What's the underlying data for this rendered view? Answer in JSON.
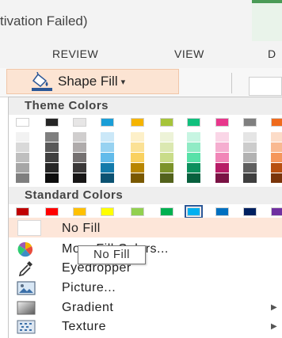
{
  "window": {
    "title": "tivation Failed)"
  },
  "tabs": [
    {
      "label": "REVIEW"
    },
    {
      "label": "VIEW"
    },
    {
      "label": "D"
    }
  ],
  "ribbon": {
    "shape_fill_label": "Shape Fill",
    "shape_fill_icon": "paint-bucket-icon",
    "caret": "▾"
  },
  "menu": {
    "theme_colors_header": "Theme Colors",
    "standard_colors_header": "Standard Colors",
    "theme_colors": [
      {
        "base": "#ffffff",
        "shades": [
          "#f2f2f2",
          "#d9d9d9",
          "#bfbfbf",
          "#a6a6a6",
          "#7f7f7f"
        ]
      },
      {
        "base": "#262626",
        "shades": [
          "#7f7f7f",
          "#595959",
          "#404040",
          "#262626",
          "#0d0d0d"
        ]
      },
      {
        "base": "#e7e6e6",
        "shades": [
          "#d0cece",
          "#afabab",
          "#757171",
          "#3a3838",
          "#171616"
        ]
      },
      {
        "base": "#1a9ed7",
        "shades": [
          "#cbe8f8",
          "#97d2f1",
          "#62bbea",
          "#137bab",
          "#0c5272"
        ]
      },
      {
        "base": "#f5b400",
        "shades": [
          "#fdf0c9",
          "#fbe195",
          "#f9d160",
          "#b88600",
          "#7a5900"
        ]
      },
      {
        "base": "#a6c43a",
        "shades": [
          "#edf3d8",
          "#dbe8b1",
          "#c9dc89",
          "#7c932a",
          "#53621c"
        ]
      },
      {
        "base": "#10c07d",
        "shades": [
          "#c7f5e2",
          "#90ebc5",
          "#58e1a8",
          "#0c905d",
          "#08603e"
        ]
      },
      {
        "base": "#e8378c",
        "shades": [
          "#fad6e7",
          "#f5aed0",
          "#f186b8",
          "#b71b66",
          "#7a1244"
        ]
      },
      {
        "base": "#7f7f7f",
        "shades": [
          "#e5e5e5",
          "#cccccc",
          "#b2b2b2",
          "#5f5f5f",
          "#3f3f3f"
        ]
      },
      {
        "base": "#ef6b1c",
        "shades": [
          "#fcdcc8",
          "#f9b991",
          "#f5975b",
          "#b8500f",
          "#7a350a"
        ]
      }
    ],
    "standard_colors": [
      "#c00000",
      "#ff0000",
      "#ffc000",
      "#ffff00",
      "#92d050",
      "#00b050",
      "#00b0f0",
      "#0070c0",
      "#002060",
      "#7030a0"
    ],
    "items": [
      {
        "label": "No Fill",
        "icon": ""
      },
      {
        "label": "More Fill Colors...",
        "icon": "color-wheel-icon"
      },
      {
        "label": "Eyedropper",
        "icon": "eyedropper-icon"
      },
      {
        "label": "Picture...",
        "icon": "picture-icon"
      },
      {
        "label": "Gradient",
        "icon": "gradient-icon"
      },
      {
        "label": "Texture",
        "icon": "texture-icon"
      }
    ],
    "tooltip": "No Fill"
  }
}
